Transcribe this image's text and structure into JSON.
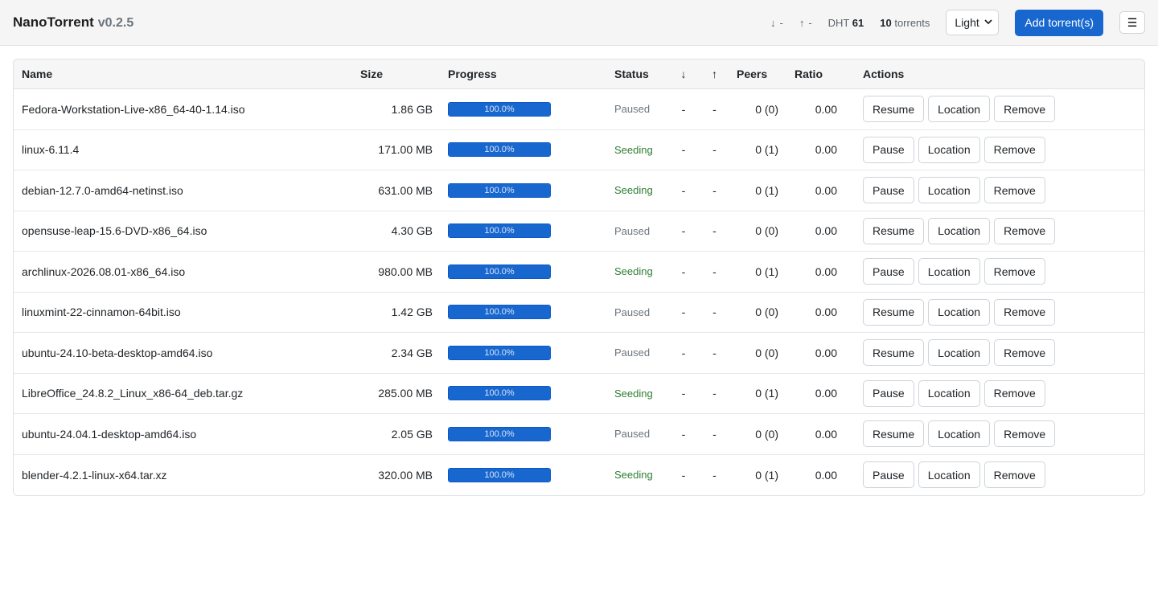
{
  "header": {
    "app_name": "NanoTorrent",
    "version": "v0.2.5",
    "down_arrow": "↓",
    "down_rate": "-",
    "up_arrow": "↑",
    "up_rate": "-",
    "dht_label": "DHT",
    "dht_value": "61",
    "torrent_count": "10",
    "torrent_label": "torrents",
    "theme_value": "Light",
    "add_button": "Add torrent(s)",
    "menu_icon": "☰"
  },
  "table": {
    "columns": {
      "name": "Name",
      "size": "Size",
      "progress": "Progress",
      "status": "Status",
      "down": "↓",
      "up": "↑",
      "peers": "Peers",
      "ratio": "Ratio",
      "actions": "Actions"
    },
    "rows": [
      {
        "name": "Fedora-Workstation-Live-x86_64-40-1.14.iso",
        "size": "1.86 GB",
        "progress_text": "100.0%",
        "progress": 1.0,
        "status": "Paused",
        "down": "-",
        "up": "-",
        "peers": "0 (0)",
        "ratio": "0.00",
        "toggle": "Resume",
        "location": "Location",
        "remove": "Remove"
      },
      {
        "name": "linux-6.11.4",
        "size": "171.00 MB",
        "progress_text": "100.0%",
        "progress": 1.0,
        "status": "Seeding",
        "down": "-",
        "up": "-",
        "peers": "0 (1)",
        "ratio": "0.00",
        "toggle": "Pause",
        "location": "Location",
        "remove": "Remove"
      },
      {
        "name": "debian-12.7.0-amd64-netinst.iso",
        "size": "631.00 MB",
        "progress_text": "100.0%",
        "progress": 1.0,
        "status": "Seeding",
        "down": "-",
        "up": "-",
        "peers": "0 (1)",
        "ratio": "0.00",
        "toggle": "Pause",
        "location": "Location",
        "remove": "Remove"
      },
      {
        "name": "opensuse-leap-15.6-DVD-x86_64.iso",
        "size": "4.30 GB",
        "progress_text": "100.0%",
        "progress": 1.0,
        "status": "Paused",
        "down": "-",
        "up": "-",
        "peers": "0 (0)",
        "ratio": "0.00",
        "toggle": "Resume",
        "location": "Location",
        "remove": "Remove"
      },
      {
        "name": "archlinux-2026.08.01-x86_64.iso",
        "size": "980.00 MB",
        "progress_text": "100.0%",
        "progress": 1.0,
        "status": "Seeding",
        "down": "-",
        "up": "-",
        "peers": "0 (1)",
        "ratio": "0.00",
        "toggle": "Pause",
        "location": "Location",
        "remove": "Remove"
      },
      {
        "name": "linuxmint-22-cinnamon-64bit.iso",
        "size": "1.42 GB",
        "progress_text": "100.0%",
        "progress": 1.0,
        "status": "Paused",
        "down": "-",
        "up": "-",
        "peers": "0 (0)",
        "ratio": "0.00",
        "toggle": "Resume",
        "location": "Location",
        "remove": "Remove"
      },
      {
        "name": "ubuntu-24.10-beta-desktop-amd64.iso",
        "size": "2.34 GB",
        "progress_text": "100.0%",
        "progress": 1.0,
        "status": "Paused",
        "down": "-",
        "up": "-",
        "peers": "0 (0)",
        "ratio": "0.00",
        "toggle": "Resume",
        "location": "Location",
        "remove": "Remove"
      },
      {
        "name": "LibreOffice_24.8.2_Linux_x86-64_deb.tar.gz",
        "size": "285.00 MB",
        "progress_text": "100.0%",
        "progress": 1.0,
        "status": "Seeding",
        "down": "-",
        "up": "-",
        "peers": "0 (1)",
        "ratio": "0.00",
        "toggle": "Pause",
        "location": "Location",
        "remove": "Remove"
      },
      {
        "name": "ubuntu-24.04.1-desktop-amd64.iso",
        "size": "2.05 GB",
        "progress_text": "100.0%",
        "progress": 1.0,
        "status": "Paused",
        "down": "-",
        "up": "-",
        "peers": "0 (0)",
        "ratio": "0.00",
        "toggle": "Resume",
        "location": "Location",
        "remove": "Remove"
      },
      {
        "name": "blender-4.2.1-linux-x64.tar.xz",
        "size": "320.00 MB",
        "progress_text": "100.0%",
        "progress": 1.0,
        "status": "Seeding",
        "down": "-",
        "up": "-",
        "peers": "0 (1)",
        "ratio": "0.00",
        "toggle": "Pause",
        "location": "Location",
        "remove": "Remove"
      }
    ]
  },
  "colors": {
    "accent": "#1767cf",
    "seeding": "#2e7d32",
    "paused": "#6c757d"
  }
}
